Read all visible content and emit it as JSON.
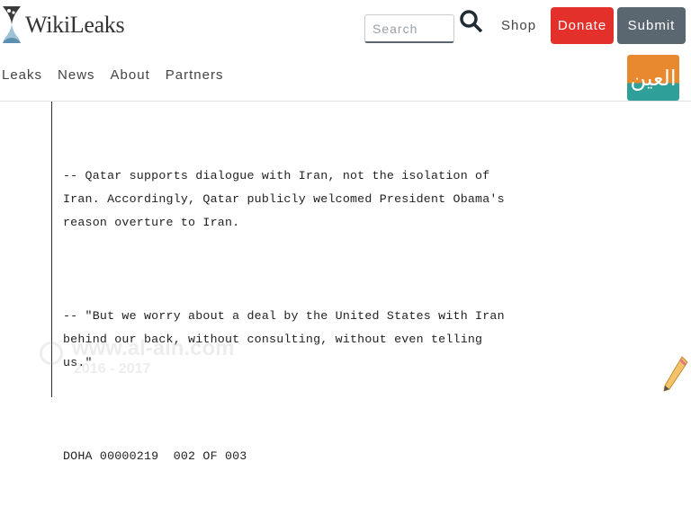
{
  "header": {
    "logo_text": "WikiLeaks",
    "search_placeholder": "Search",
    "shop_label": "Shop",
    "donate_label": "Donate",
    "submit_label": "Submit",
    "badge_text": "العين"
  },
  "nav": {
    "items": [
      "Leaks",
      "News",
      "About",
      "Partners"
    ]
  },
  "document": {
    "paragraphs": [
      "-- Qatar supports dialogue with Iran, not the isolation of\nIran. Accordingly, Qatar publicly welcomed President Obama's\nreason overture to Iran.",
      "-- \"But we worry about a deal by the United States with Iran\nbehind our back, without consulting, without even telling\nus.\""
    ],
    "reference": "DOHA 00000219  002 OF 003"
  },
  "watermark": {
    "line1": "www.al-ain.com",
    "line2": "2016 - 2017"
  },
  "colors": {
    "donate": "#e4302a",
    "submit": "#5a6670",
    "badge_top": "#e8892f",
    "badge_bottom": "#2f9f9a"
  }
}
